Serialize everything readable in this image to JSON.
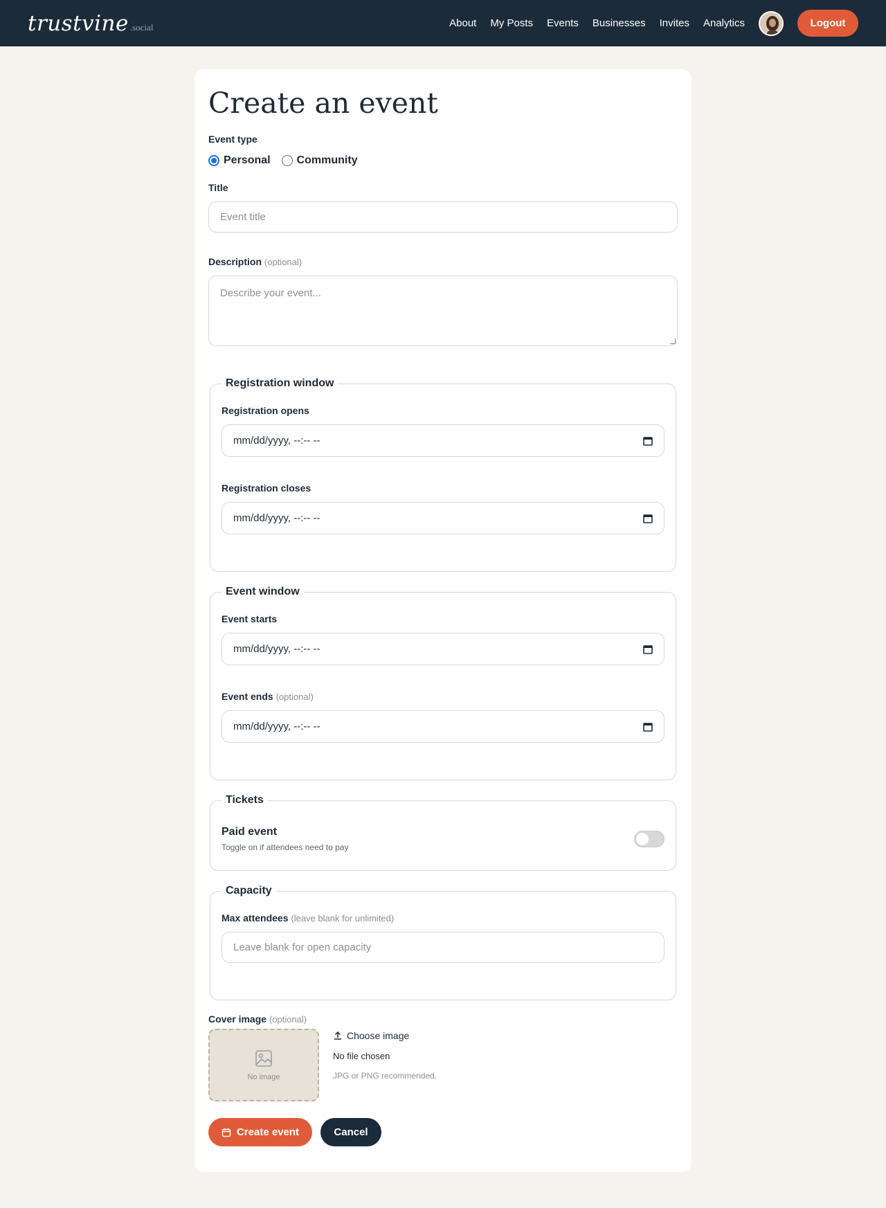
{
  "brand": {
    "name": "trustvine",
    "suffix": ".social"
  },
  "nav": {
    "links": [
      "About",
      "My Posts",
      "Events",
      "Businesses",
      "Invites",
      "Analytics"
    ],
    "logout_label": "Logout"
  },
  "form": {
    "title": "Create an event",
    "event_type": {
      "label": "Event type",
      "options": [
        "Personal",
        "Community"
      ],
      "selected": "Personal"
    },
    "title_field": {
      "label": "Title",
      "placeholder": "Event title"
    },
    "description": {
      "label": "Description",
      "optional": "(optional)",
      "placeholder": "Describe your event..."
    },
    "registration_window": {
      "legend": "Registration window",
      "opens": {
        "label": "Registration opens",
        "value": "mm/dd/yyyy, --:-- --"
      },
      "closes": {
        "label": "Registration closes",
        "value": "mm/dd/yyyy, --:-- --"
      }
    },
    "event_window": {
      "legend": "Event window",
      "starts": {
        "label": "Event starts",
        "value": "mm/dd/yyyy, --:-- --"
      },
      "ends": {
        "label": "Event ends",
        "optional": "(optional)",
        "value": "mm/dd/yyyy, --:-- --"
      }
    },
    "tickets": {
      "legend": "Tickets",
      "paid_label": "Paid event",
      "paid_help": "Toggle on if attendees need to pay",
      "paid_enabled": false
    },
    "capacity": {
      "legend": "Capacity",
      "label": "Max attendees",
      "hint": "(leave blank for unlimited)",
      "placeholder": "Leave blank for open capacity"
    },
    "cover_image": {
      "label": "Cover image",
      "optional": "(optional)",
      "preview_label": "No image",
      "choose_label": "Choose image",
      "file_status": "No file chosen",
      "help": "JPG or PNG recommended."
    },
    "actions": {
      "submit_label": "Create event",
      "cancel_label": "Cancel"
    }
  },
  "colors": {
    "nav_bg": "#1b2b3a",
    "accent": "#e05b38",
    "page_bg": "#f6f3ee"
  }
}
